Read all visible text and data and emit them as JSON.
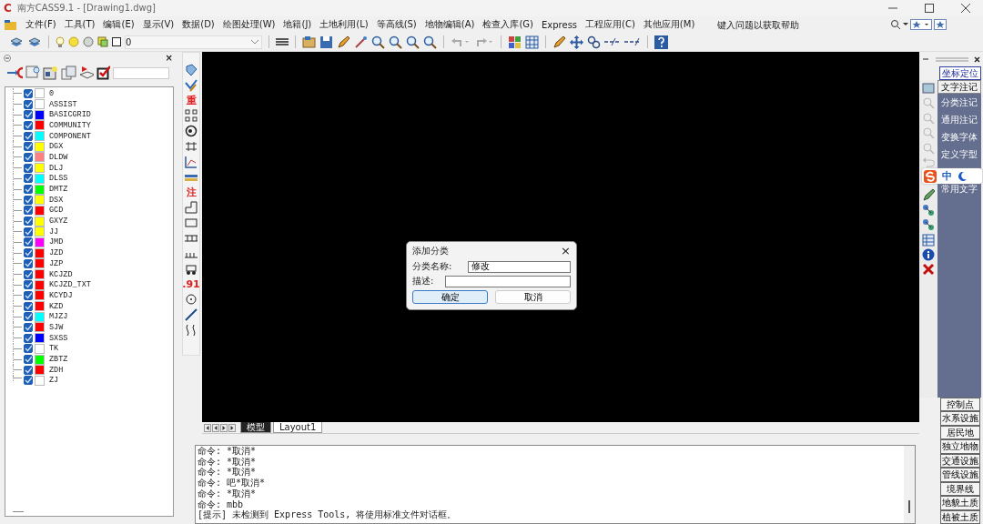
{
  "window": {
    "title": "南方CASS9.1 - [Drawing1.dwg]",
    "app_logo": "C"
  },
  "menu": [
    "文件(F)",
    "工具(T)",
    "编辑(E)",
    "显示(V)",
    "数据(D)",
    "绘图处理(W)",
    "地籍(J)",
    "土地利用(L)",
    "等高线(S)",
    "地物编辑(A)",
    "检查入库(G)",
    "Express",
    "工程应用(C)",
    "其他应用(M)"
  ],
  "help_box": {
    "placeholder": "键入问题以获取帮助"
  },
  "layer_combo": {
    "value": "0"
  },
  "layers_panel": {
    "close": "×",
    "layers": [
      {
        "name": "0",
        "color": "#ffffff",
        "checked": true
      },
      {
        "name": "ASSIST",
        "color": "#ffffff",
        "checked": true
      },
      {
        "name": "BASICGRID",
        "color": "#0000ff",
        "checked": true
      },
      {
        "name": "COMMUNITY",
        "color": "#ff0000",
        "checked": true
      },
      {
        "name": "COMPONENT",
        "color": "#00ffff",
        "checked": true
      },
      {
        "name": "DGX",
        "color": "#ffff00",
        "checked": true
      },
      {
        "name": "DLDW",
        "color": "#ff8080",
        "checked": true
      },
      {
        "name": "DLJ",
        "color": "#ffff00",
        "checked": true
      },
      {
        "name": "DLSS",
        "color": "#00ffff",
        "checked": true
      },
      {
        "name": "DMTZ",
        "color": "#00ff00",
        "checked": true
      },
      {
        "name": "DSX",
        "color": "#ffff00",
        "checked": true
      },
      {
        "name": "GCD",
        "color": "#ff0000",
        "checked": true
      },
      {
        "name": "GXYZ",
        "color": "#ffff00",
        "checked": true
      },
      {
        "name": "JJ",
        "color": "#ffff00",
        "checked": true
      },
      {
        "name": "JMD",
        "color": "#ff00ff",
        "checked": true
      },
      {
        "name": "JZD",
        "color": "#ff0000",
        "checked": true
      },
      {
        "name": "JZP",
        "color": "#ff0000",
        "checked": true
      },
      {
        "name": "KCJZD",
        "color": "#ff0000",
        "checked": true
      },
      {
        "name": "KCJZD_TXT",
        "color": "#ff0000",
        "checked": true
      },
      {
        "name": "KCYDJ",
        "color": "#ff0000",
        "checked": true
      },
      {
        "name": "KZD",
        "color": "#ff0000",
        "checked": true
      },
      {
        "name": "MJZJ",
        "color": "#00ffff",
        "checked": true
      },
      {
        "name": "SJW",
        "color": "#ff0000",
        "checked": true
      },
      {
        "name": "SXSS",
        "color": "#0000ff",
        "checked": true
      },
      {
        "name": "TK",
        "color": "#ffffff",
        "checked": true
      },
      {
        "name": "ZBTZ",
        "color": "#00ff00",
        "checked": true
      },
      {
        "name": "ZDH",
        "color": "#ff0000",
        "checked": true
      },
      {
        "name": "ZJ",
        "color": "#ffffff",
        "checked": true
      }
    ]
  },
  "draw_toolbar": [
    {
      "kind": "tag"
    },
    {
      "kind": "pen"
    },
    {
      "kind": "glyph",
      "text": "重"
    },
    {
      "kind": "grid"
    },
    {
      "kind": "wheel"
    },
    {
      "kind": "dim"
    },
    {
      "kind": "chart"
    },
    {
      "kind": "ruler"
    },
    {
      "kind": "glyph",
      "text": "注"
    },
    {
      "kind": "step"
    },
    {
      "kind": "rect"
    },
    {
      "kind": "rail"
    },
    {
      "kind": "comb"
    },
    {
      "kind": "car"
    },
    {
      "kind": "glyph",
      "text": ".91"
    },
    {
      "kind": "circle"
    },
    {
      "kind": "line"
    },
    {
      "kind": "wave"
    }
  ],
  "dialog": {
    "title": "添加分类",
    "close": "×",
    "fields": [
      {
        "label": "分类名称:",
        "value": "修改"
      },
      {
        "label": "描述:"
      }
    ],
    "buttons": [
      {
        "label": "确定",
        "selected": true
      },
      {
        "label": "取消",
        "selected": false
      }
    ]
  },
  "tabs": [
    {
      "label": "模型",
      "selected": true
    },
    {
      "label": "Layout1",
      "selected": false
    }
  ],
  "command_lines": [
    "命令: *取消*",
    "命令: *取消*",
    "命令: *取消*",
    "命令: 吧*取消*",
    "命令: *取消*",
    "命令: mbb",
    "[提示] 未检测到 Express Tools, 将使用标准文件对话框。"
  ],
  "right_panel": {
    "top_button": "坐标定位",
    "category": "文字注记",
    "items": [
      "分类注记",
      "通用注记",
      "变换字体",
      "定义字型"
    ],
    "items_below_ime": [
      "常用文字"
    ],
    "ime": "中",
    "categories": [
      "控制点",
      "水系设施",
      "居民地",
      "独立地物",
      "交通设施",
      "管线设施",
      "境界线",
      "地貌土质",
      "植被土质"
    ]
  }
}
